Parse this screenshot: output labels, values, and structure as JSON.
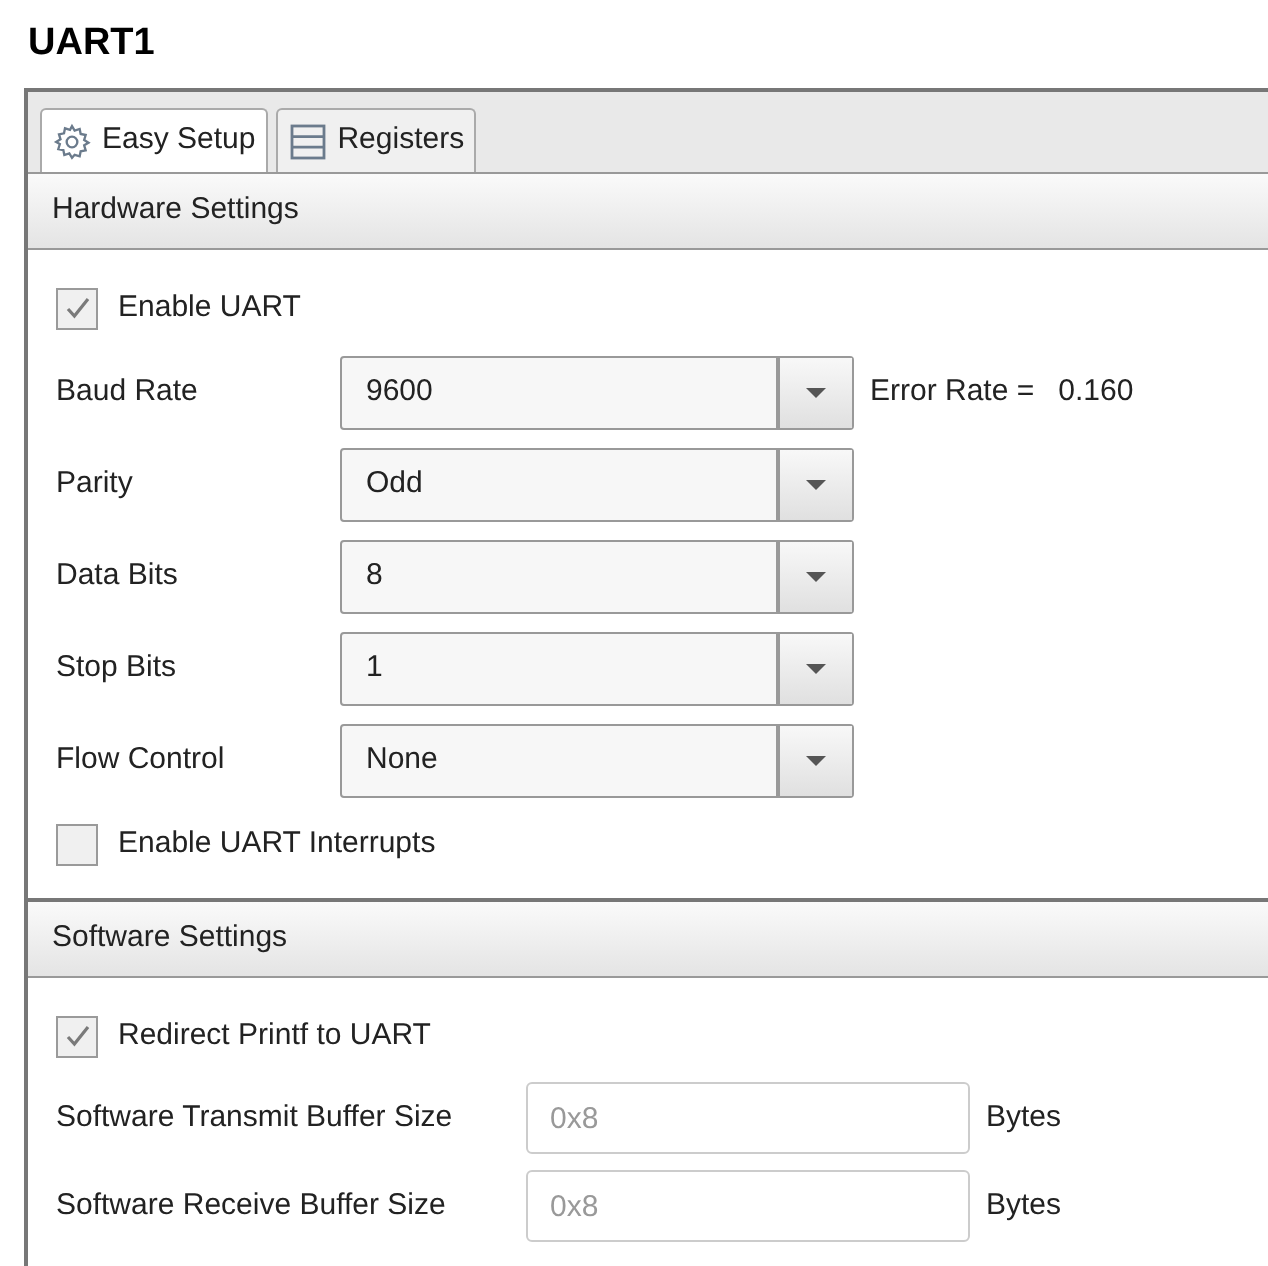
{
  "title": "UART1",
  "tabs": [
    {
      "label": "Easy Setup",
      "selected": true
    },
    {
      "label": "Registers",
      "selected": false
    }
  ],
  "sections": [
    {
      "title": "Hardware Settings",
      "rows": [
        {
          "kind": "checkbox",
          "label": "Enable UART",
          "checked": true
        },
        {
          "kind": "combo",
          "label": "Baud Rate",
          "value": "9600",
          "note_label": "Error Rate =",
          "note_value": "0.160"
        },
        {
          "kind": "combo",
          "label": "Parity",
          "value": "Odd"
        },
        {
          "kind": "combo",
          "label": "Data Bits",
          "value": "8"
        },
        {
          "kind": "combo",
          "label": "Stop Bits",
          "value": "1"
        },
        {
          "kind": "combo",
          "label": "Flow Control",
          "value": "None"
        },
        {
          "kind": "checkbox",
          "label": "Enable UART Interrupts",
          "checked": false
        }
      ]
    },
    {
      "title": "Software Settings",
      "rows": [
        {
          "kind": "checkbox",
          "label": "Redirect Printf to UART",
          "checked": true
        },
        {
          "kind": "text",
          "label": "Software Transmit Buffer Size",
          "placeholder": "0x8",
          "unit": "Bytes"
        },
        {
          "kind": "text",
          "label": "Software Receive Buffer Size",
          "placeholder": "0x8",
          "unit": "Bytes"
        }
      ]
    }
  ]
}
